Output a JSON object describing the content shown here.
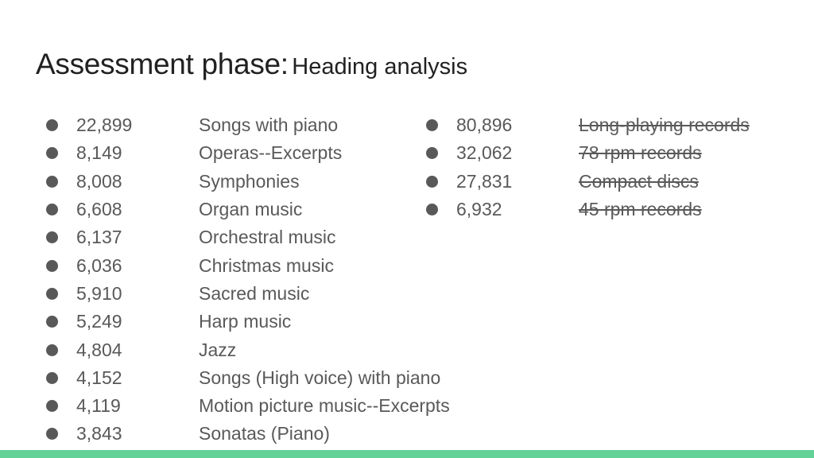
{
  "slide": {
    "title_main": "Assessment phase:",
    "title_sub": "Heading analysis",
    "accent_color": "#63d297"
  },
  "left_list": [
    {
      "count": "22,899",
      "label": "Songs with piano"
    },
    {
      "count": "8,149",
      "label": "Operas--Excerpts"
    },
    {
      "count": "8,008",
      "label": "Symphonies"
    },
    {
      "count": "6,608",
      "label": "Organ music"
    },
    {
      "count": "6,137",
      "label": "Orchestral music"
    },
    {
      "count": "6,036",
      "label": "Christmas music"
    },
    {
      "count": "5,910",
      "label": "Sacred music"
    },
    {
      "count": "5,249",
      "label": "Harp music"
    },
    {
      "count": "4,804",
      "label": "Jazz"
    },
    {
      "count": "4,152",
      "label": "Songs (High voice) with piano"
    },
    {
      "count": "4,119",
      "label": "Motion picture music--Excerpts"
    },
    {
      "count": "3,843",
      "label": "Sonatas (Piano)"
    }
  ],
  "right_list": [
    {
      "count": "80,896",
      "label": "Long-playing records",
      "struck": true
    },
    {
      "count": "32,062",
      "label": "78 rpm records",
      "struck": true
    },
    {
      "count": "27,831",
      "label": "Compact discs",
      "struck": true
    },
    {
      "count": "6,932",
      "label": "45 rpm records",
      "struck": true
    }
  ]
}
